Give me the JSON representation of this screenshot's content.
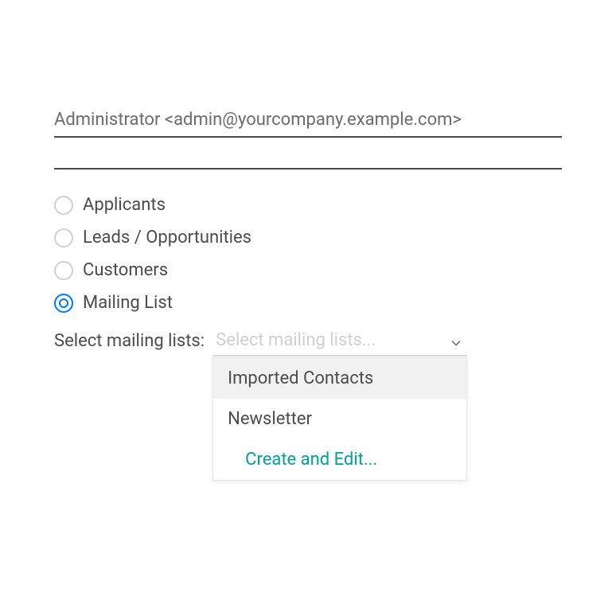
{
  "from_field": {
    "value": "Administrator <admin@yourcompany.example.com>"
  },
  "radios": {
    "applicants": "Applicants",
    "leads": "Leads / Opportunities",
    "customers": "Customers",
    "mailing_list": "Mailing List"
  },
  "mailing_select": {
    "label": "Select mailing lists:",
    "placeholder": "Select mailing lists...",
    "options": {
      "imported": "Imported Contacts",
      "newsletter": "Newsletter",
      "create_edit": "Create and Edit..."
    }
  }
}
